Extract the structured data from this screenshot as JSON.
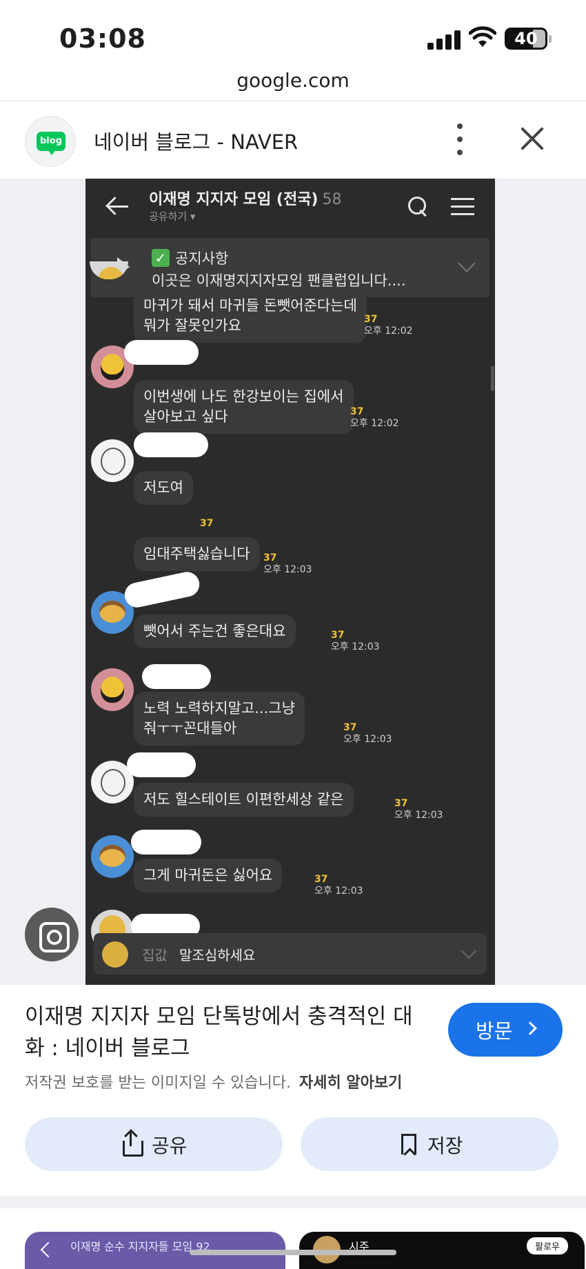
{
  "status_bar": {
    "time": "03:08",
    "battery": "40"
  },
  "browser": {
    "url": "google.com"
  },
  "source": {
    "logo_text": "blog",
    "title": "네이버 블로그 - NAVER"
  },
  "chat": {
    "room_title": "이재명 지지자 모임 (전국)",
    "member_count": "58",
    "share_label": "공유하기 ▾",
    "notice_title": "공지사항",
    "notice_text": "이곳은 이재명지지자모임 팬클럽입니다....",
    "messages": [
      {
        "text": "마귀가 돼서 마귀들 돈뺏어준다는데\n뭐가 잘못인가요",
        "count": "37",
        "time": "오후 12:02"
      },
      {
        "text": "이번생에 나도 한강보이는 집에서\n살아보고 싶다",
        "count": "37",
        "time": "오후 12:02"
      },
      {
        "text": "저도여",
        "count": "37",
        "time": ""
      },
      {
        "text": "임대주택싫습니다",
        "count": "37",
        "time": "오후 12:03"
      },
      {
        "text": "뺏어서 주는건 좋은대요",
        "count": "37",
        "time": "오후 12:03"
      },
      {
        "text": "노력 노력하지말고...그냥\n줘ㅜㅜ꼰대들아",
        "count": "37",
        "time": "오후 12:03"
      },
      {
        "text": "저도 힐스테이트 이편한세상 같은",
        "count": "37",
        "time": "오후 12:03"
      },
      {
        "text": "그게 마귀돈은 싫어요",
        "count": "37",
        "time": "오후 12:03"
      }
    ],
    "input_prefix": "집값",
    "input_text": "말조심하세요"
  },
  "result": {
    "title": "이재명 지지자 모임 단톡방에서 충격적인 대화 : 네이버 블로그",
    "visit_label": "방문",
    "copyright_text": "저작권 보호를 받는 이미지일 수 있습니다.",
    "learn_more": "자세히 알아보기",
    "share_label": "공유",
    "save_label": "저장"
  },
  "related": {
    "left_text": "이재명 순수 지지자들 모임 92",
    "right_text": "시주",
    "right_follow": "팔로우"
  }
}
